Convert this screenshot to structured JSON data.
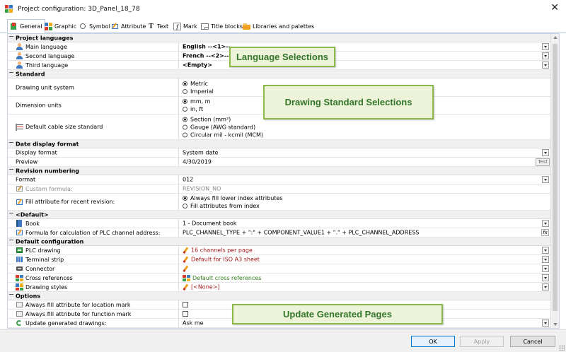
{
  "window": {
    "title": "Project configuration: 3D_Panel_18_78",
    "close_label": "✕"
  },
  "tabs": [
    {
      "label": "General",
      "icon": "general-icon",
      "active": true
    },
    {
      "label": "Graphic",
      "icon": "graphic-icon"
    },
    {
      "label": "Symbol",
      "icon": "symbol-icon"
    },
    {
      "label": "Attribute",
      "icon": "attribute-icon"
    },
    {
      "label": "Text",
      "icon": "text-icon",
      "glyph": "T"
    },
    {
      "label": "Mark",
      "icon": "mark-icon",
      "glyph": "f"
    },
    {
      "label": "Title blocks",
      "icon": "title-blocks-icon"
    },
    {
      "label": "Libraries and palettes",
      "icon": "libraries-icon"
    }
  ],
  "sections": {
    "project_languages": {
      "title": "Project languages",
      "main_language": {
        "label": "Main language",
        "value": "English --<1>--"
      },
      "second_language": {
        "label": "Second language",
        "value": "French --<2>--"
      },
      "third_language": {
        "label": "Third language",
        "value": "<Empty>"
      }
    },
    "standard": {
      "title": "Standard",
      "drawing_unit_system": {
        "label": "Drawing unit system",
        "options": [
          "Metric",
          "Imperial"
        ]
      },
      "dimension_units": {
        "label": "Dimension units",
        "options": [
          "mm, m",
          "in, ft"
        ]
      },
      "cable_size": {
        "label": "Default cable size standard",
        "options": [
          "Section (mm²)",
          "Gauge (AWG standard)",
          "Circular mil - kcmil (MCM)"
        ]
      }
    },
    "date_display": {
      "title": "Date display format",
      "display_format": {
        "label": "Display format",
        "value": "System date"
      },
      "preview": {
        "label": "Preview",
        "value": "4/30/2019",
        "button": "Test"
      }
    },
    "revision": {
      "title": "Revision numbering",
      "format": {
        "label": "Format",
        "value": "012"
      },
      "custom_formula": {
        "label": "Custom formula:",
        "value": "REVISION_NO"
      },
      "fill_attribute": {
        "label": "Fill attribute for recent revision:",
        "options": [
          "Always fill lower index attributes",
          "Fill attributes from index"
        ]
      }
    },
    "default": {
      "title": "<Default>",
      "book": {
        "label": "Book",
        "value": "1 - Document book"
      },
      "plc_formula": {
        "label": "Formula for calculation of PLC channel address:",
        "value": "PLC_CHANNEL_TYPE + \":\" + COMPONENT_VALUE1 + \".\" + PLC_CHANNEL_ADDRESS",
        "button": "fx"
      }
    },
    "default_config": {
      "title": "Default configuration",
      "plc_drawing": {
        "label": "PLC drawing",
        "value": "16 channels per page"
      },
      "terminal_strip": {
        "label": "Terminal strip",
        "value": "Default for ISO A3 sheet"
      },
      "connector": {
        "label": "Connector",
        "value": ""
      },
      "cross_references": {
        "label": "Cross references",
        "value": "Default cross references"
      },
      "drawing_styles": {
        "label": "Drawing styles",
        "value": "[<None>]"
      }
    },
    "options": {
      "title": "Options",
      "location_mark": {
        "label": "Always fill attribute for location mark"
      },
      "function_mark": {
        "label": "Always fill attribute for function mark"
      },
      "update_drawings": {
        "label": "Update generated drawings:",
        "value": "Ask me"
      }
    }
  },
  "callouts": {
    "language": "Language Selections",
    "standard": "Drawing Standard Selections",
    "update": "Update Generated Pages"
  },
  "buttons": {
    "ok": "OK",
    "apply": "Apply",
    "cancel": "Cancel"
  },
  "colors": {
    "callout_border": "#8cb74a",
    "callout_text": "#33752b",
    "link_green": "#2e7d1a",
    "link_red": "#a11b1b",
    "accent": "#0078d7"
  }
}
